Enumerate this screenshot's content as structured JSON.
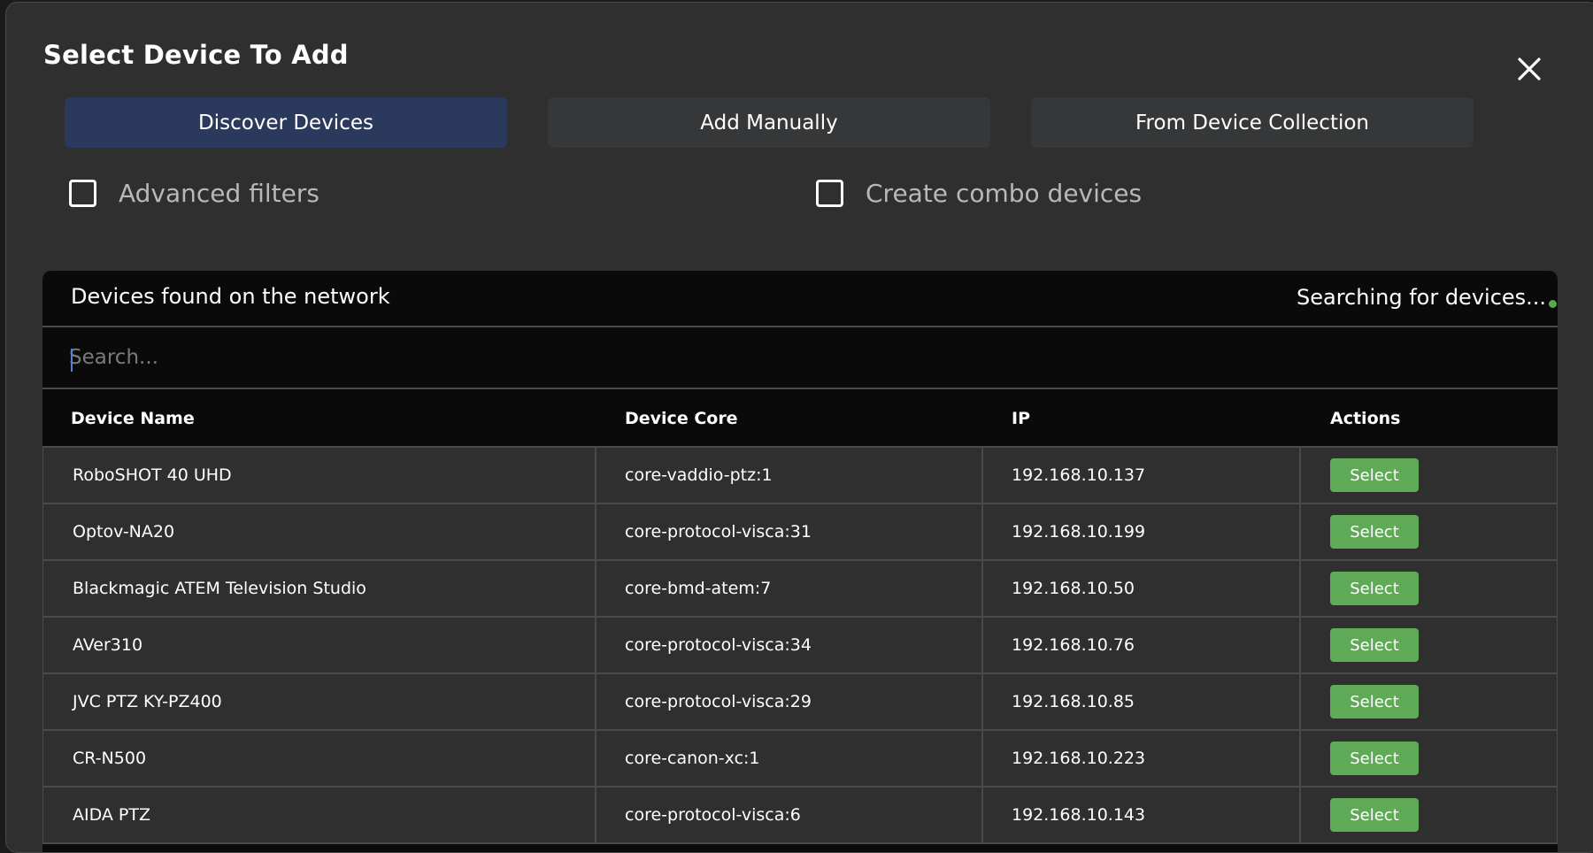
{
  "dialog": {
    "title": "Select Device To Add",
    "close_icon": "close-icon"
  },
  "tabs": [
    {
      "label": "Discover Devices",
      "active": true
    },
    {
      "label": "Add Manually",
      "active": false
    },
    {
      "label": "From Device Collection",
      "active": false
    }
  ],
  "options": {
    "advanced_filters": {
      "label": "Advanced filters",
      "checked": false
    },
    "combo_devices": {
      "label": "Create combo devices",
      "checked": false
    }
  },
  "panel": {
    "title": "Devices found on the network",
    "status": "Searching for devices...",
    "status_color": "#5aa84f"
  },
  "search": {
    "placeholder": "Search...",
    "value": ""
  },
  "table": {
    "columns": [
      "Device Name",
      "Device Core",
      "IP",
      "Actions"
    ],
    "rows": [
      {
        "name": "RoboSHOT 40 UHD",
        "core": "core-vaddio-ptz:1",
        "ip": "192.168.10.137",
        "action": "Select"
      },
      {
        "name": "Optov-NA20",
        "core": "core-protocol-visca:31",
        "ip": "192.168.10.199",
        "action": "Select"
      },
      {
        "name": "Blackmagic ATEM Television Studio",
        "core": "core-bmd-atem:7",
        "ip": "192.168.10.50",
        "action": "Select"
      },
      {
        "name": "AVer310",
        "core": "core-protocol-visca:34",
        "ip": "192.168.10.76",
        "action": "Select"
      },
      {
        "name": "JVC PTZ KY-PZ400",
        "core": "core-protocol-visca:29",
        "ip": "192.168.10.85",
        "action": "Select"
      },
      {
        "name": "CR-N500",
        "core": "core-canon-xc:1",
        "ip": "192.168.10.223",
        "action": "Select"
      },
      {
        "name": "AIDA PTZ",
        "core": "core-protocol-visca:6",
        "ip": "192.168.10.143",
        "action": "Select"
      }
    ]
  },
  "colors": {
    "active_tab": "#2b3a5c",
    "select_button": "#5eaa56",
    "dialog_bg": "#2f2f2f",
    "panel_bg": "#0a0a0a"
  }
}
